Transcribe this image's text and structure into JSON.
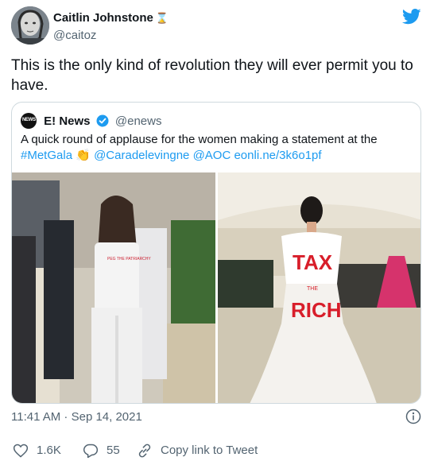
{
  "author": {
    "name": "Caitlin Johnstone",
    "badge": "⌛",
    "handle": "@caitoz"
  },
  "tweet": {
    "text": "This is the only kind of revolution they will ever permit you to have."
  },
  "quote": {
    "logo_text": "NEWS",
    "name": "E! News",
    "handle": "@enews",
    "text_line1": "A quick round of applause for the women making a statement at the",
    "hashtag": "#MetGala",
    "emoji": "👏",
    "mention1": "@Caradelevingne",
    "mention2": "@AOC",
    "link": "eonli.ne/3k6o1pf",
    "image_left_text": "PEG THE PATRIARCHY",
    "image_right_text1": "TAX",
    "image_right_text2": "THE",
    "image_right_text3": "RICH"
  },
  "meta": {
    "timestamp": "11:41 AM · Sep 14, 2021"
  },
  "actions": {
    "likes": "1.6K",
    "replies": "55",
    "copy_link": "Copy link to Tweet"
  },
  "colors": {
    "accent": "#1d9bf0",
    "text": "#0f1419",
    "muted": "#536471",
    "border": "#cfd9de"
  }
}
